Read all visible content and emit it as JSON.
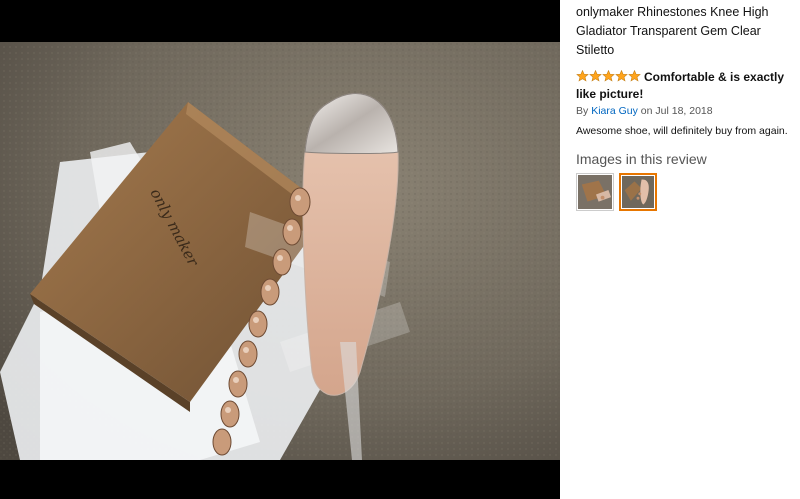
{
  "product": {
    "title": "onlymaker Rhinestones Knee High Gladiator Transparent Gem Clear Stiletto"
  },
  "review": {
    "rating": 5,
    "rating_max": 5,
    "star_color": "#ffa41c",
    "title": "Comfortable & is exactly like picture!",
    "by_prefix": "By",
    "author": "Kiara Guy",
    "date": "on Jul 18, 2018",
    "body": "Awesome shoe, will definitely buy from again."
  },
  "images_section": {
    "heading": "Images in this review",
    "thumbnails": [
      {
        "selected": false
      },
      {
        "selected": true
      }
    ]
  },
  "photo": {
    "box_logo_text": "only maker"
  },
  "colors": {
    "link": "#0066c0",
    "selected_border": "#e77600"
  }
}
